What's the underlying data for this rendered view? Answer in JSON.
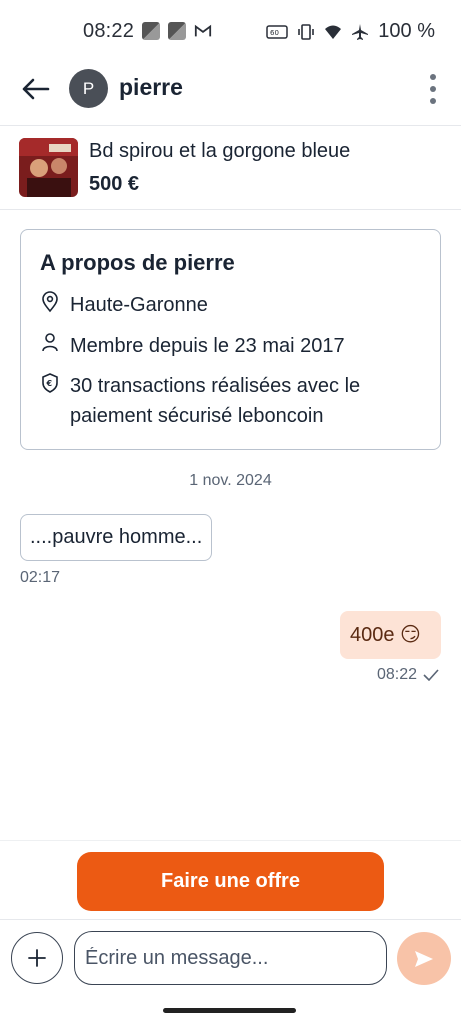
{
  "status_bar": {
    "time": "08:22",
    "battery": "100 %"
  },
  "header": {
    "avatar_letter": "P",
    "contact_name": "pierre"
  },
  "listing": {
    "title": "Bd spirou et la gorgone bleue",
    "price": "500 €"
  },
  "about": {
    "title": "A propos de pierre",
    "location": "Haute-Garonne",
    "member_since": "Membre depuis le 23 mai 2017",
    "transactions": "30 transactions réalisées avec le paiement sécurisé leboncoin"
  },
  "conversation": {
    "date_separator": "1 nov. 2024",
    "messages": [
      {
        "direction": "incoming",
        "text": "....pauvre homme...",
        "time": "02:17"
      },
      {
        "direction": "outgoing",
        "text": "400e 😏",
        "time": "08:22",
        "status": "sent-check"
      }
    ]
  },
  "offer": {
    "button_label": "Faire une offre"
  },
  "composer": {
    "placeholder": "Écrire un message..."
  },
  "colors": {
    "accent": "#ec5a13",
    "outgoing_bubble": "#fde3d6",
    "send_button_disabled": "#f8c3a8",
    "border": "#b9c2ce"
  },
  "icons": [
    "back-arrow-icon",
    "more-vertical-icon",
    "location-pin-icon",
    "person-icon",
    "secure-payment-icon",
    "check-icon",
    "plus-icon",
    "send-icon"
  ]
}
